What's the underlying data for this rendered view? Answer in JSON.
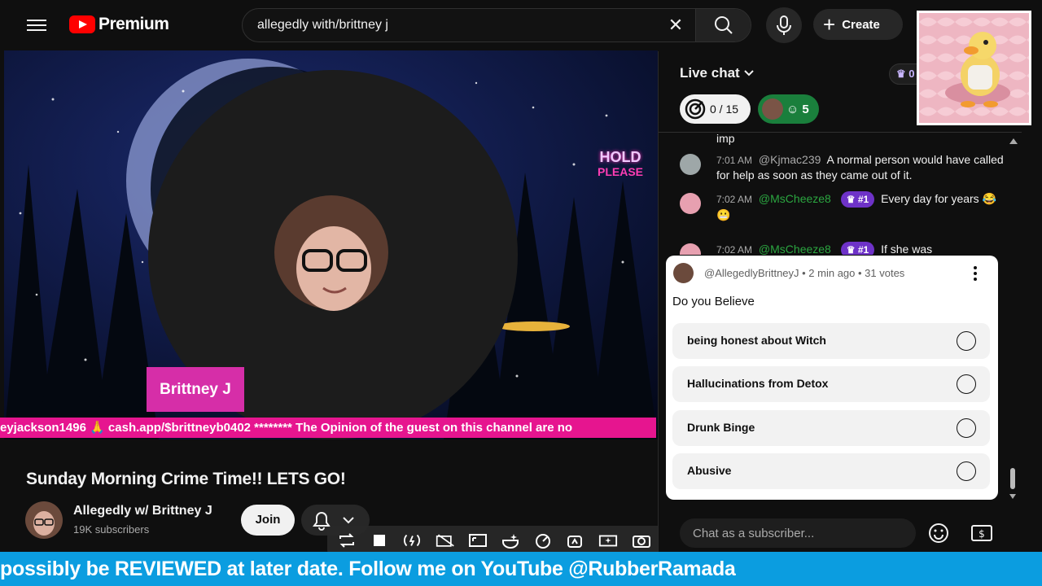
{
  "header": {
    "brand": "Premium",
    "search_value": "allegedly with/brittney j",
    "create_label": "Create"
  },
  "video": {
    "hold_line1": "HOLD",
    "hold_line2": "PLEASE",
    "name_tag": "Brittney J",
    "ticker": "eyjackson1496 🙏 cash.app/$brittneyb0402 ******** The Opinion of the guest on this channel are no"
  },
  "details": {
    "title": "Sunday Morning Crime Time!! LETS GO!",
    "channel_name": "Allegedly w/ Brittney J",
    "subscribers": "19K subscribers",
    "join_label": "Join"
  },
  "chat": {
    "title": "Live chat",
    "crown_count": "0",
    "goal": "0 / 15",
    "mod_count": "5",
    "messages": [
      {
        "time": "",
        "author": "",
        "text": "imp",
        "rank": ""
      },
      {
        "time": "7:01 AM",
        "author": "@Kjmac239",
        "text": "A normal person would have called for help as soon as they came out of it.",
        "rank": ""
      },
      {
        "time": "7:02 AM",
        "author": "@MsCheeze8",
        "text": "Every day for years 😂 😬",
        "rank": "#1"
      },
      {
        "time": "7:02 AM",
        "author": "@MsCheeze8",
        "text": "If she was",
        "rank": "#1"
      }
    ],
    "input_placeholder": "Chat as a subscriber...",
    "colors": {
      "member": "#2ba640",
      "rank_badge": "#6e32c8",
      "mod_pill": "#1a7f3c"
    }
  },
  "poll": {
    "meta": "@AllegedlyBrittneyJ • 2 min ago • 31 votes",
    "question": "Do you Believe",
    "options": [
      "being honest about Witch",
      "Hallucinations from Detox",
      "Drunk Binge",
      "Abusive"
    ]
  },
  "banner": {
    "text": "possibly be REVIEWED at later date. Follow me on YouTube @RubberRamada",
    "color": "#0b9de0"
  }
}
